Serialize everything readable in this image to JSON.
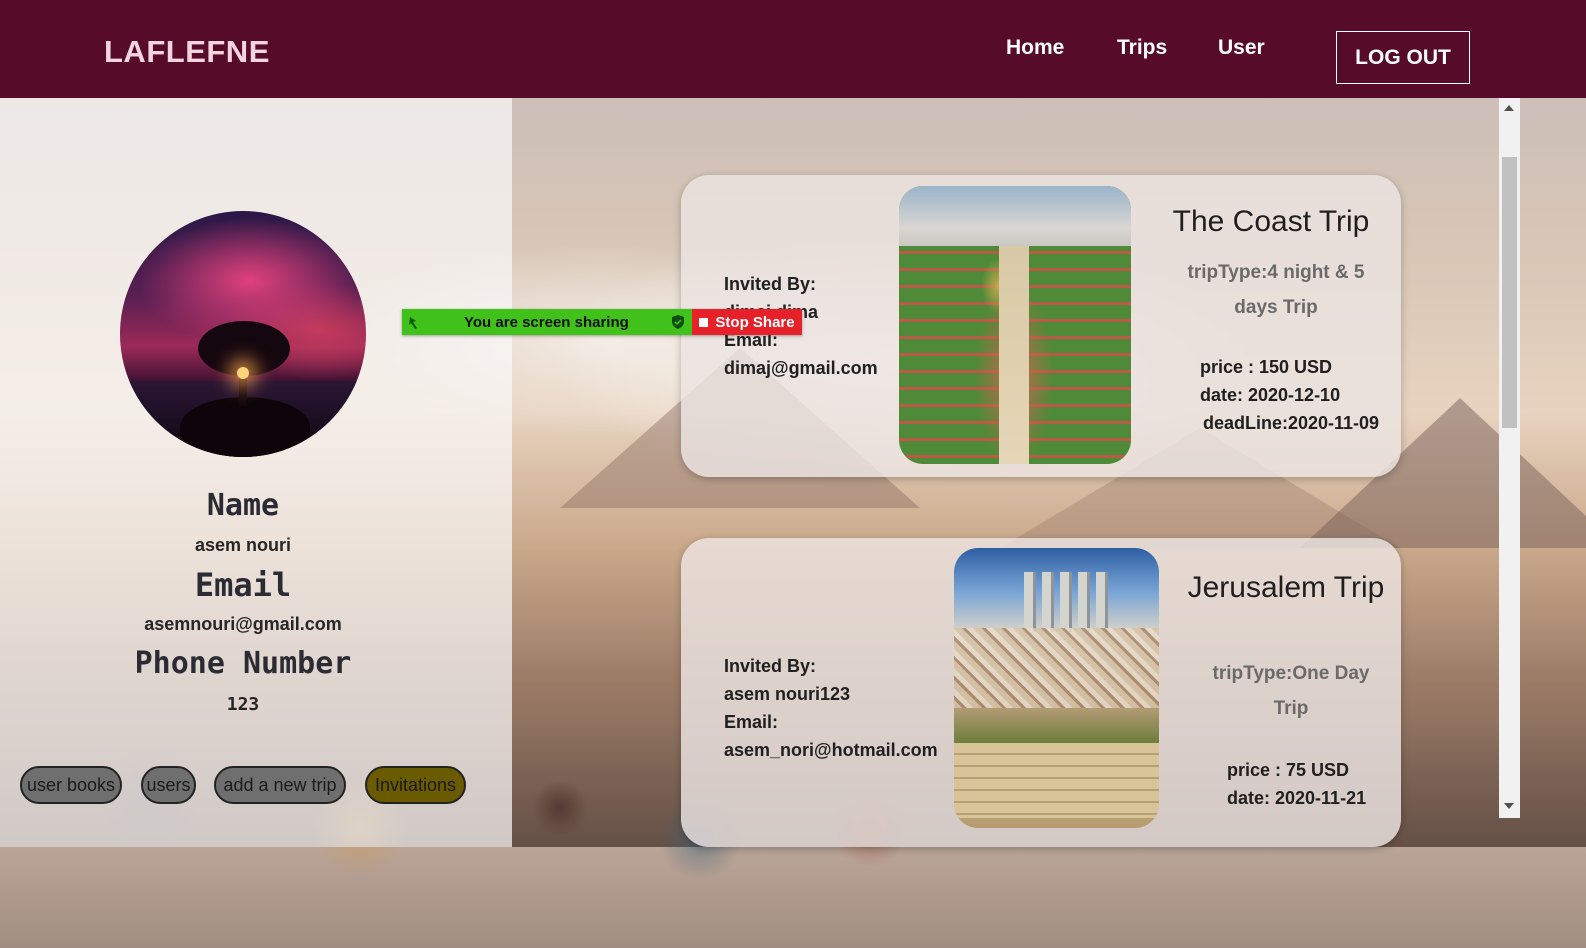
{
  "header": {
    "logo": "LAFLEFNE",
    "nav": [
      "Home",
      "Trips",
      "User"
    ],
    "logout_label": "LOG OUT"
  },
  "profile": {
    "name_heading": "Name",
    "name_value": "asem nouri",
    "email_heading": "Email",
    "email_value": "asemnouri@gmail.com",
    "phone_heading": "Phone Number",
    "phone_value": "123",
    "buttons": [
      "user books",
      "users",
      "add a new trip",
      "Invitations"
    ],
    "active_button": "Invitations"
  },
  "screen_share": {
    "message": "You are screen sharing",
    "stop_label": "Stop Share"
  },
  "invitations": [
    {
      "invited_by_label": "Invited By:",
      "invited_by": "dimaj dima",
      "email_label": "Email:",
      "email": "dimaj@gmail.com",
      "title": "The Coast Trip",
      "trip_type": "tripType:4 night & 5 days Trip",
      "price": "price : 150 USD",
      "date": "date: 2020-12-10",
      "deadline": "deadLine:2020-11-09"
    },
    {
      "invited_by_label": "Invited By:",
      "invited_by": "asem nouri123",
      "email_label": "Email:",
      "email": "asem_nori@hotmail.com",
      "title": "Jerusalem Trip",
      "trip_type": "tripType:One Day Trip",
      "price": "price : 75 USD",
      "date": "date: 2020-11-21"
    }
  ],
  "colors": {
    "header_bg": "#560b28",
    "share_green": "#41c21b",
    "share_red": "#e62129",
    "invitations_active": "#6b5b00"
  }
}
